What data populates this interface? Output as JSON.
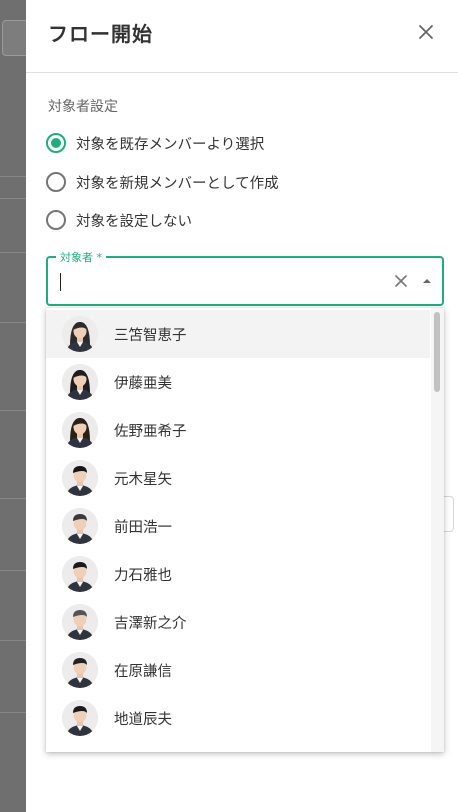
{
  "drawer": {
    "title": "フロー開始"
  },
  "target_settings": {
    "section_label": "対象者設定",
    "options": [
      {
        "label": "対象を既存メンバーより選択",
        "checked": true
      },
      {
        "label": "対象を新規メンバーとして作成",
        "checked": false
      },
      {
        "label": "対象を設定しない",
        "checked": false
      }
    ]
  },
  "target_field": {
    "label": "対象者 *",
    "value": ""
  },
  "members": [
    {
      "name": "三笘智恵子",
      "avatar": "woman-avatar",
      "highlighted": true
    },
    {
      "name": "伊藤亜美",
      "avatar": "woman-avatar"
    },
    {
      "name": "佐野亜希子",
      "avatar": "woman-avatar"
    },
    {
      "name": "元木星矢",
      "avatar": "man-avatar"
    },
    {
      "name": "前田浩一",
      "avatar": "man-avatar"
    },
    {
      "name": "力石雅也",
      "avatar": "man-avatar"
    },
    {
      "name": "吉澤新之介",
      "avatar": "man-avatar"
    },
    {
      "name": "在原謙信",
      "avatar": "man-avatar"
    },
    {
      "name": "地道辰夫",
      "avatar": "man-avatar"
    }
  ],
  "colors": {
    "accent": "#1fae7a",
    "overlay": "#7a7a7a"
  }
}
